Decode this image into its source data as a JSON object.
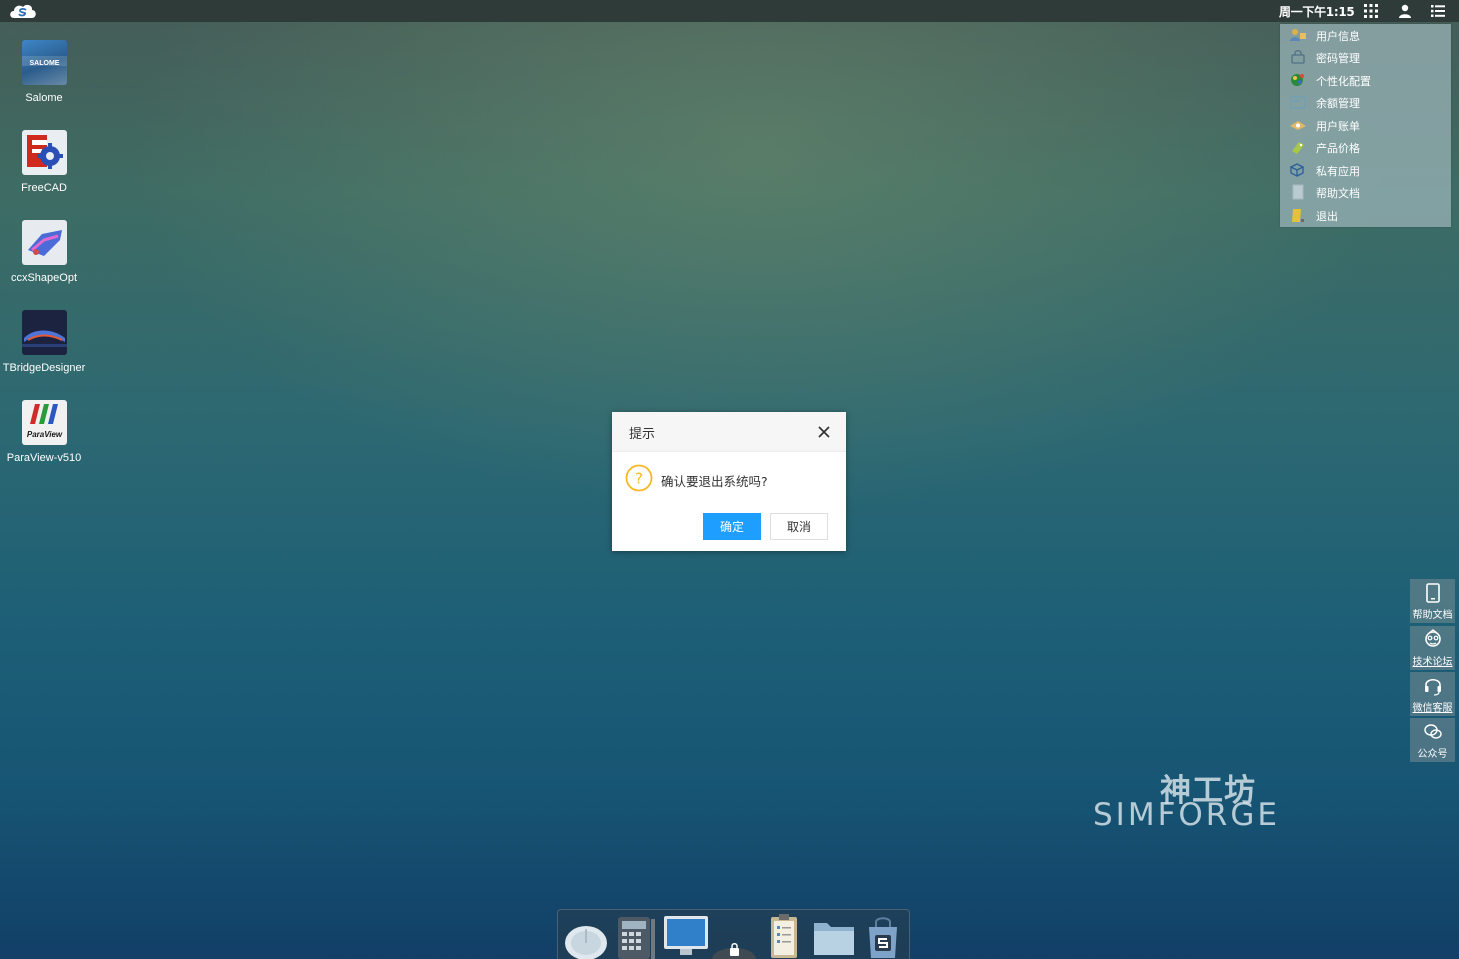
{
  "topbar": {
    "clock": "周一下午1:15",
    "icons": [
      "apps-grid-icon",
      "user-icon",
      "menu-list-icon"
    ]
  },
  "user_menu": {
    "items": [
      {
        "label": "用户信息",
        "icon": "user-info-icon"
      },
      {
        "label": "密码管理",
        "icon": "password-icon"
      },
      {
        "label": "个性化配置",
        "icon": "personalize-icon"
      },
      {
        "label": "余额管理",
        "icon": "balance-icon"
      },
      {
        "label": "用户账单",
        "icon": "bill-icon"
      },
      {
        "label": "产品价格",
        "icon": "price-tag-icon"
      },
      {
        "label": "私有应用",
        "icon": "private-apps-icon"
      },
      {
        "label": "帮助文档",
        "icon": "help-doc-icon"
      },
      {
        "label": "退出",
        "icon": "logout-icon"
      }
    ]
  },
  "desktop": {
    "icons": [
      {
        "name": "Salome"
      },
      {
        "name": "FreeCAD"
      },
      {
        "name": "ccxShapeOpt"
      },
      {
        "name": "TBridgeDesigner"
      },
      {
        "name": "ParaView-v510"
      }
    ],
    "salome_logo_text": "SALOME",
    "paraview_logo_text": "ParaView"
  },
  "dialog": {
    "title": "提示",
    "message": "确认要退出系统吗?",
    "ok_label": "确定",
    "cancel_label": "取消"
  },
  "side_buttons": [
    {
      "label": "帮助文档",
      "icon": "tablet-icon"
    },
    {
      "label": "技术论坛",
      "icon": "forum-avatar-icon"
    },
    {
      "label": "微信客服",
      "icon": "headset-icon"
    },
    {
      "label": "公众号",
      "icon": "wechat-icon"
    }
  ],
  "brand": {
    "cn": "神工坊",
    "en": "SIMFORGE"
  },
  "dock": {
    "items": [
      "mouse-icon",
      "calculator-icon",
      "monitor-icon",
      "lock-icon",
      "clipboard-icon",
      "folder-icon",
      "store-bag-icon"
    ]
  },
  "colors": {
    "primary_button": "#1e9fff",
    "topbar": "#2f3b38",
    "menu_bg": "#96afb4"
  }
}
